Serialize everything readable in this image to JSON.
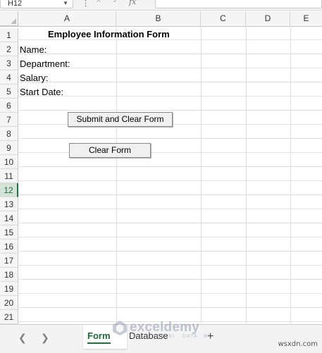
{
  "formula_bar": {
    "name_box": "H12",
    "fx": "fx"
  },
  "columns": [
    "A",
    "B",
    "C",
    "D",
    "E"
  ],
  "rows": [
    "1",
    "2",
    "3",
    "4",
    "5",
    "6",
    "7",
    "8",
    "9",
    "10",
    "11",
    "12",
    "13",
    "14",
    "15",
    "16",
    "17",
    "18",
    "19",
    "20",
    "21"
  ],
  "selected_row": "12",
  "cells": {
    "title": "Employee Information Form",
    "name_label": "Name:",
    "department_label": "Department:",
    "salary_label": "Salary:",
    "start_date_label": "Start Date:"
  },
  "buttons": {
    "submit_clear": "Submit and Clear Form",
    "clear": "Clear Form"
  },
  "sheet_tabs": [
    {
      "label": "Form",
      "active": true
    },
    {
      "label": "Database",
      "active": false
    }
  ],
  "watermark": {
    "brand": "exceldemy",
    "tagline": "EXCEL · DATA · BI"
  },
  "credit": "wsxdn.com",
  "colors": {
    "accent": "#1e7145",
    "header_bg": "#f5f5f5",
    "gridline": "#e1e1e1"
  }
}
